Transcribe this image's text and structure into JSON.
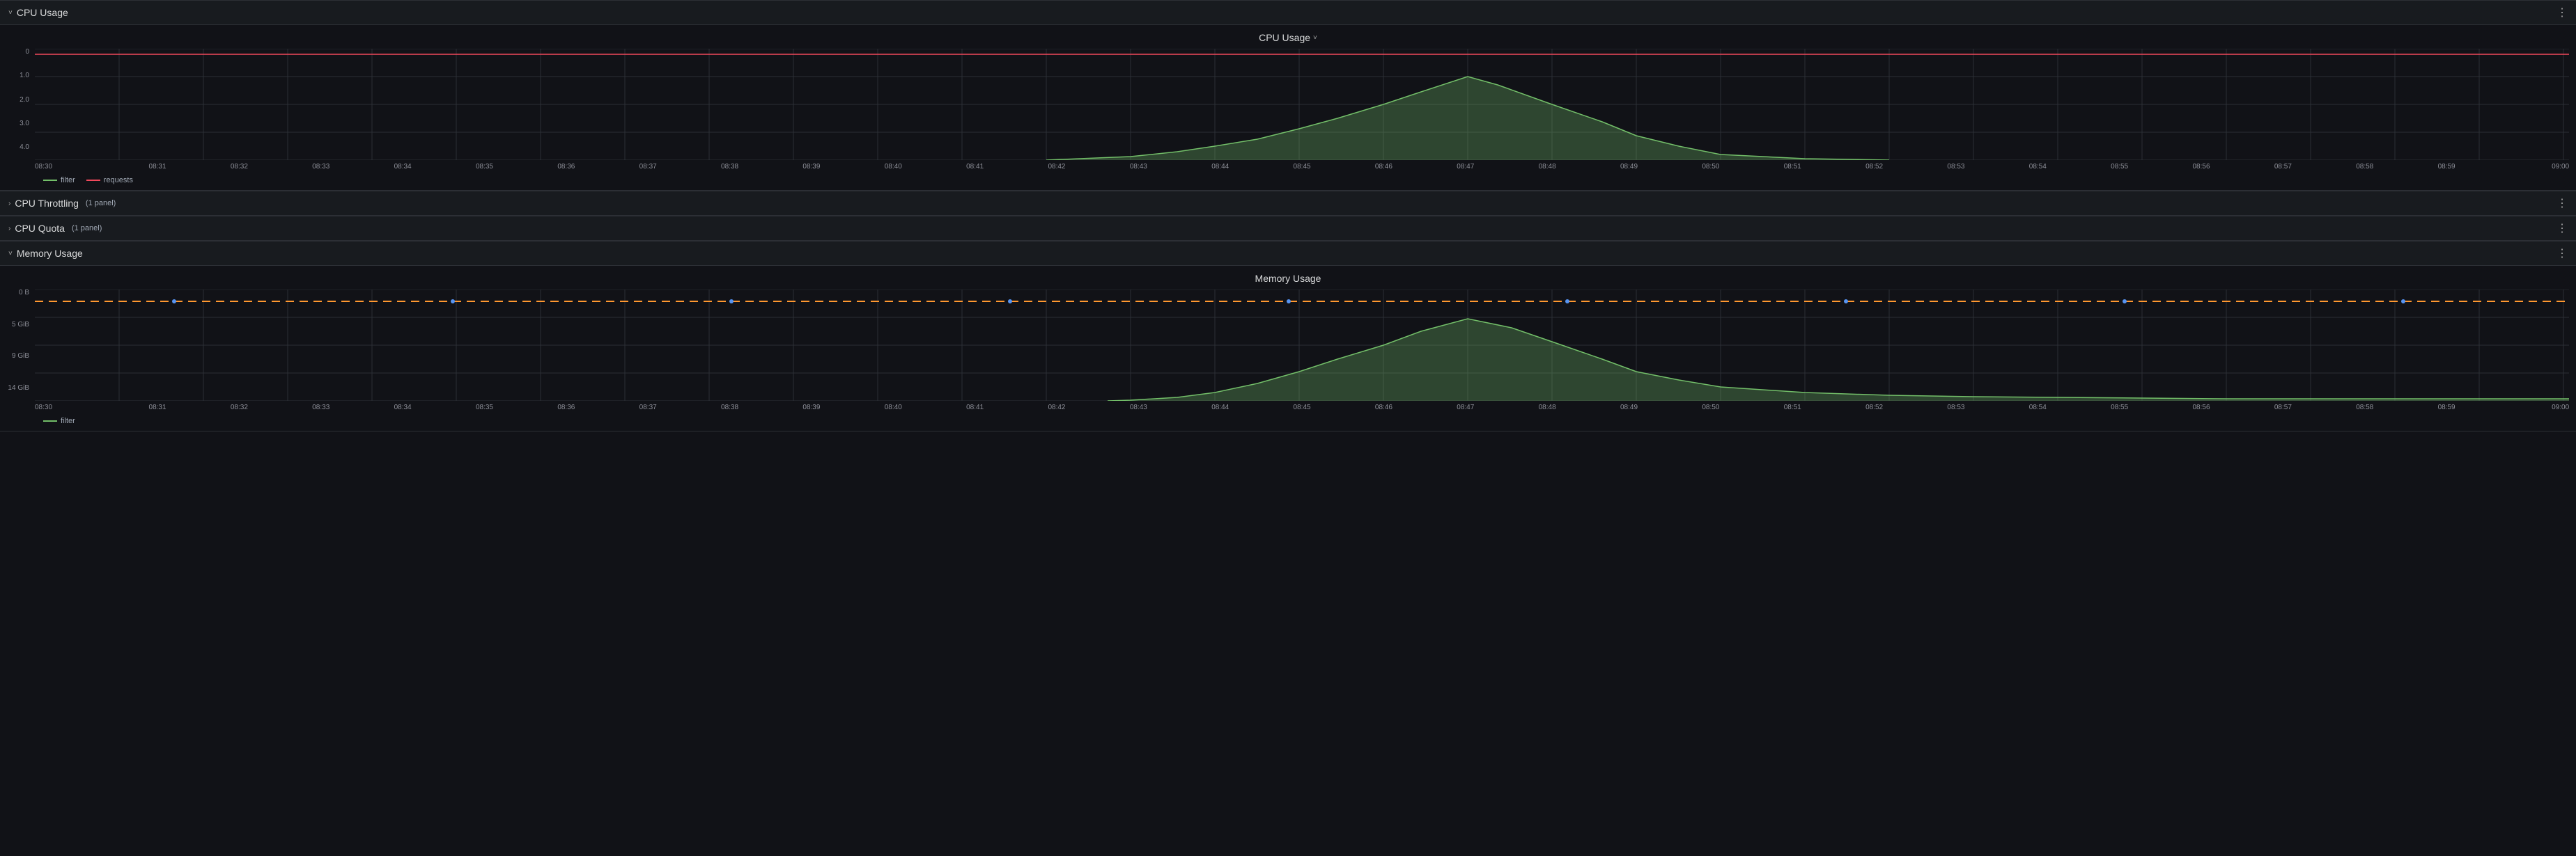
{
  "sections": [
    {
      "id": "cpu-usage",
      "title": "CPU Usage",
      "expanded": true,
      "chevron": "˅",
      "chart": {
        "title": "CPU Usage",
        "hasDropdown": true,
        "yAxis": [
          "0",
          "1.0",
          "2.0",
          "3.0",
          "4.0"
        ],
        "xAxis": [
          "08:30",
          "08:31",
          "08:32",
          "08:33",
          "08:34",
          "08:35",
          "08:36",
          "08:37",
          "08:38",
          "08:39",
          "08:40",
          "08:41",
          "08:42",
          "08:43",
          "08:44",
          "08:45",
          "08:46",
          "08:47",
          "08:48",
          "08:49",
          "08:50",
          "08:51",
          "08:52",
          "08:53",
          "08:54",
          "08:55",
          "08:56",
          "08:57",
          "08:58",
          "08:59",
          "09:00"
        ],
        "legend": [
          {
            "label": "filter",
            "color": "green",
            "type": "solid"
          },
          {
            "label": "requests",
            "color": "red",
            "type": "solid"
          }
        ],
        "height": 160
      }
    },
    {
      "id": "cpu-throttling",
      "title": "CPU Throttling",
      "subtitle": "(1 panel)",
      "expanded": false,
      "chevron": "›"
    },
    {
      "id": "cpu-quota",
      "title": "CPU Quota",
      "subtitle": "(1 panel)",
      "expanded": false,
      "chevron": "›"
    },
    {
      "id": "memory-usage",
      "title": "Memory Usage",
      "expanded": true,
      "chevron": "˅",
      "chart": {
        "title": "Memory Usage",
        "hasDropdown": false,
        "yAxis": [
          "0 B",
          "5 GiB",
          "9 GiB",
          "14 GiB"
        ],
        "xAxis": [
          "08:30",
          "08:31",
          "08:32",
          "08:33",
          "08:34",
          "08:35",
          "08:36",
          "08:37",
          "08:38",
          "08:39",
          "08:40",
          "08:41",
          "08:42",
          "08:43",
          "08:44",
          "08:45",
          "08:46",
          "08:47",
          "08:48",
          "08:49",
          "08:50",
          "08:51",
          "08:52",
          "08:53",
          "08:54",
          "08:55",
          "08:56",
          "08:57",
          "08:58",
          "08:59",
          "09:00"
        ],
        "legend": [
          {
            "label": "filter",
            "color": "green",
            "type": "solid"
          }
        ],
        "height": 160
      }
    }
  ]
}
